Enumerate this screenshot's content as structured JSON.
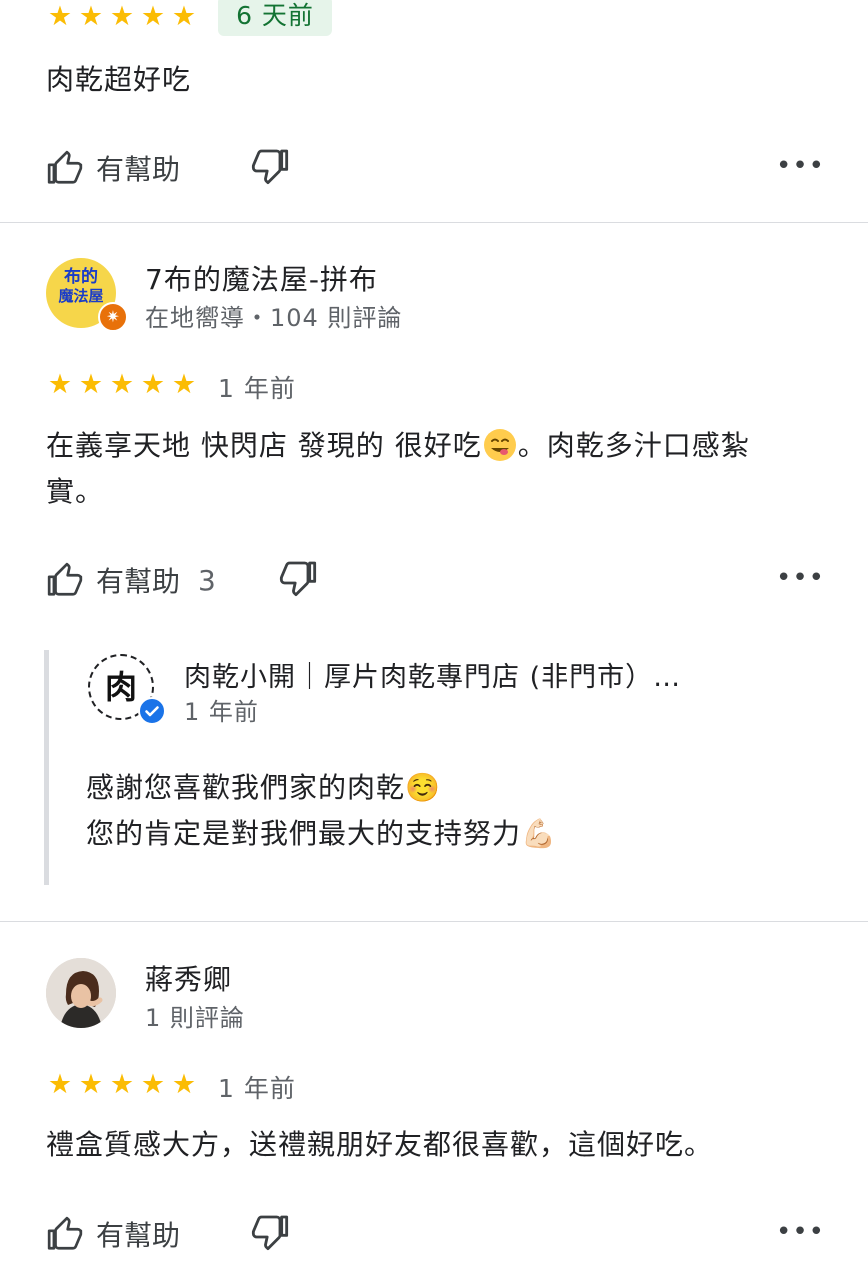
{
  "review1": {
    "rating": 5,
    "date": "6 天前",
    "text": "肉乾超好吃",
    "helpful_label": "有幫助",
    "more_label": "•••"
  },
  "review2": {
    "author": "7布的魔法屋-拼布",
    "meta": "在地嚮導・104 則評論",
    "avatar_text_1": "布的",
    "avatar_text_2": "魔法屋",
    "rating": 5,
    "date": "1 年前",
    "text_line1": "在義享天地 快閃店 發現的 很好吃",
    "text_line1_after": "。肉乾多汁口感紮",
    "text_line2": "實。",
    "helpful_label": "有幫助",
    "helpful_count": "3",
    "more_label": "•••",
    "owner_reply": {
      "name": "肉乾小開｜厚片肉乾專門店 (非門市）…",
      "avatar_text": "肉",
      "date": "1 年前",
      "line1": "感謝您喜歡我們家的肉乾",
      "line1_emoji": "☺️",
      "line2": "您的肯定是對我們最大的支持努力",
      "line2_emoji": "💪🏻"
    }
  },
  "review3": {
    "author": "蔣秀卿",
    "meta": "1 則評論",
    "rating": 5,
    "date": "1 年前",
    "text": "禮盒質感大方，送禮親朋好友都很喜歡，這個好吃。",
    "helpful_label": "有幫助",
    "more_label": "•••"
  },
  "icons": {
    "star": "★",
    "thumbs_up": "thumbs-up-icon",
    "thumbs_down": "thumbs-down-icon",
    "more": "more-icon"
  },
  "colors": {
    "star": "#fbbc04",
    "badge_bg": "#e6f4ea",
    "badge_text": "#137333",
    "divider": "#dadce0",
    "local_guide": "#e8710a",
    "verified": "#1a73e8"
  }
}
